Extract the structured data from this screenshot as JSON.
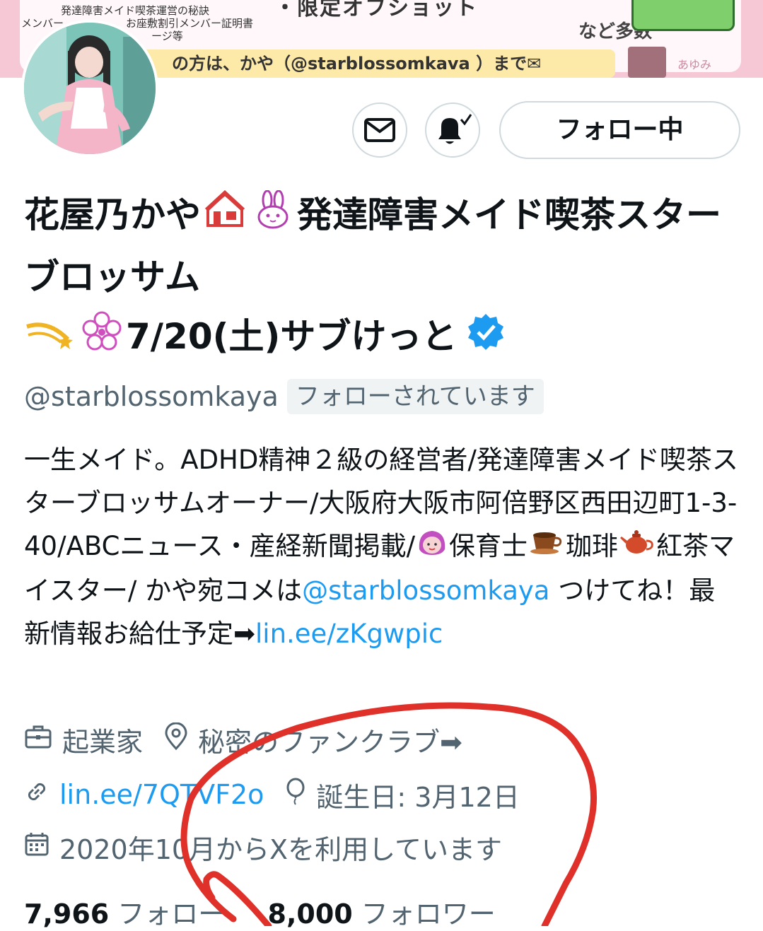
{
  "banner": {
    "note_line1": "発達障害メイド喫茶運営の秘訣",
    "note_line2a": "メンバー",
    "note_line2b": "お座敷割引メンバー証明書",
    "note_line3": "ージ等",
    "headline": "・限定オフショット",
    "more": "など多数",
    "contact": "の方は、かや（@starblossomkava ）まで✉",
    "name": "あゆみ"
  },
  "actions": {
    "follow_label": "フォロー中"
  },
  "profile": {
    "name_part1": "花屋乃かや",
    "name_part2": "発達障害メイド喫茶スターブロッサム",
    "name_part3": "7/20(土)サブけっと",
    "handle": "@starblossomkaya",
    "follows_you": "フォローされています"
  },
  "bio": {
    "t1": "一生メイド。ADHD精神２級の経営者/発達障害メイド喫茶スターブロッサムオーナー/大阪府大阪市阿倍野区西田辺町1-3-40/ABCニュース・産経新聞掲載/",
    "t2": "保育士",
    "t3": "珈琲",
    "t4": "紅茶マイスター/ かや宛コメは",
    "mention": "@starblossomkaya",
    "t5": " つけてね！最新情報お給仕予定➡",
    "link": "lin.ee/zKgwpic"
  },
  "meta": {
    "profession": "起業家",
    "location": "秘密のファンクラブ➡",
    "website": "lin.ee/7QTVF2o",
    "birthday": "誕生日: 3月12日",
    "joined": "2020年10月からXを利用しています"
  },
  "stats": {
    "following_count": "7,966",
    "following_label": "フォロー",
    "followers_count": "8,000",
    "followers_label": "フォロワー"
  },
  "colors": {
    "link": "#1d9bf0",
    "secondary": "#536471",
    "verified": "#1d9bf0",
    "annotation": "#e0302a"
  }
}
